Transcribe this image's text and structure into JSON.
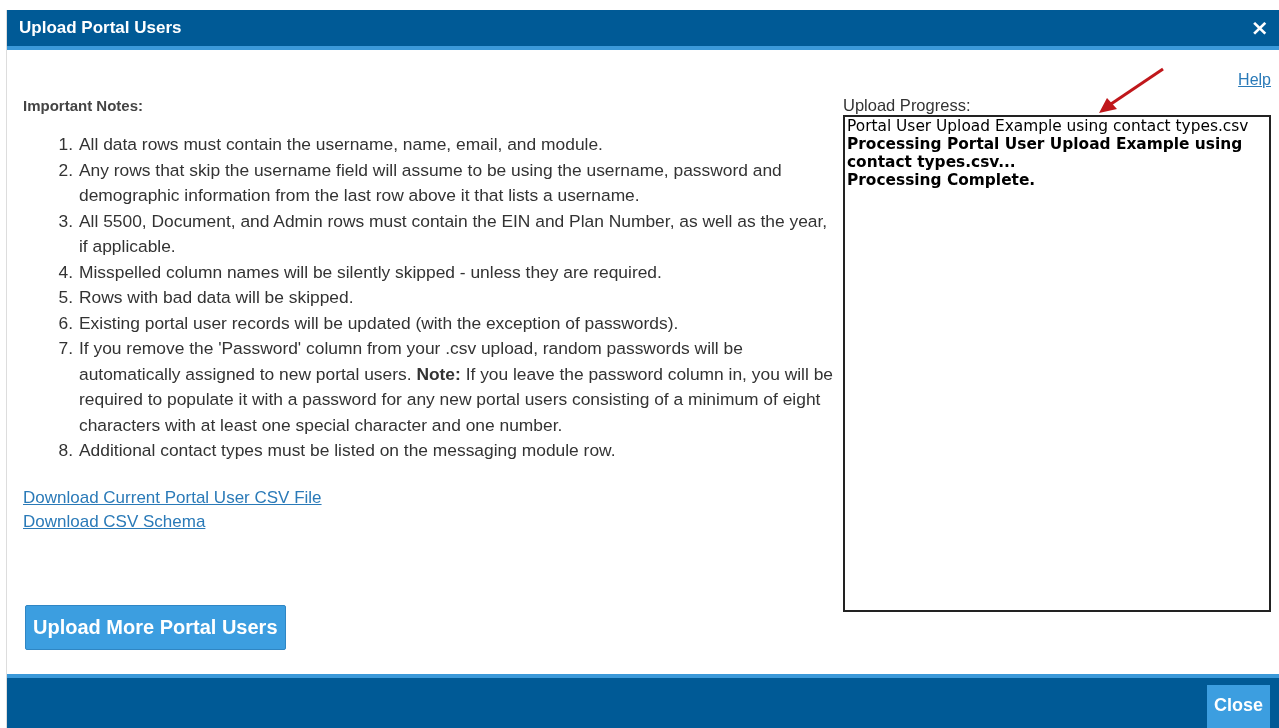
{
  "window": {
    "title": "Upload Portal Users",
    "close_symbol": "×"
  },
  "help_link": "Help",
  "notes": {
    "heading": "Important Notes:",
    "items": [
      {
        "number": "1.",
        "text": "All data rows must contain the username, name, email, and module."
      },
      {
        "number": "2.",
        "text": "Any rows that skip the username field will assume to be using the username, password and demographic information from the last row above it that lists a username."
      },
      {
        "number": "3.",
        "text": "All 5500, Document, and Admin rows must contain the EIN and Plan Number, as well as the year, if applicable."
      },
      {
        "number": "4.",
        "text": "Misspelled column names will be silently skipped - unless they are required."
      },
      {
        "number": "5.",
        "text": "Rows with bad data will be skipped."
      },
      {
        "number": "6.",
        "text": "Existing portal user records will be updated (with the exception of passwords)."
      },
      {
        "number": "7.",
        "text": "If you remove the 'Password' column from your .csv upload, random passwords will be automatically assigned to new portal users. **Note:** If you leave the password column in, you will be required to populate it with a password for any new portal users consisting of a minimum of eight characters with at least one special character and one number."
      },
      {
        "number": "8.",
        "text": "Additional contact types must be listed on the messaging module row."
      }
    ]
  },
  "links": [
    "Download Current Portal User CSV File",
    "Download CSV Schema"
  ],
  "progress": {
    "label": "Upload Progress:",
    "lines": [
      {
        "text": "Portal User Upload Example using contact types.csv",
        "bold": false
      },
      {
        "text": "Processing Portal User Upload Example using contact types.csv...",
        "bold": true
      },
      {
        "text": "Processing Complete.",
        "bold": true
      }
    ]
  },
  "upload_button": "Upload More Portal Users",
  "footer": {
    "close_button": "Close"
  }
}
